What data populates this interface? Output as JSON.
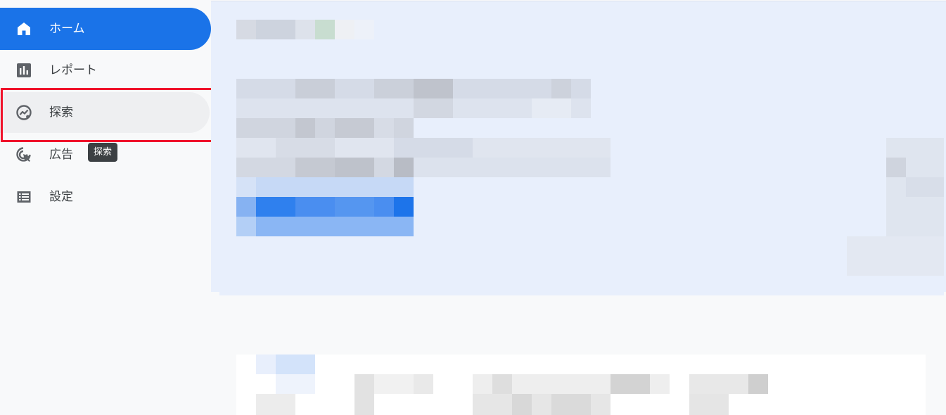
{
  "sidebar": {
    "items": [
      {
        "label": "ホーム",
        "icon": "home-icon",
        "active": true
      },
      {
        "label": "レポート",
        "icon": "bar-chart-icon",
        "active": false
      },
      {
        "label": "探索",
        "icon": "explore-icon",
        "active": false,
        "highlighted": true
      },
      {
        "label": "広告",
        "icon": "ads-icon",
        "active": false
      },
      {
        "label": "設定",
        "icon": "list-icon",
        "active": false
      }
    ]
  },
  "tooltip": {
    "text": "探索"
  },
  "colors": {
    "accent": "#1a73e8",
    "highlight_border": "#f0132b",
    "sidebar_bg": "#f8f9fa",
    "content_bg": "#e8effc"
  }
}
